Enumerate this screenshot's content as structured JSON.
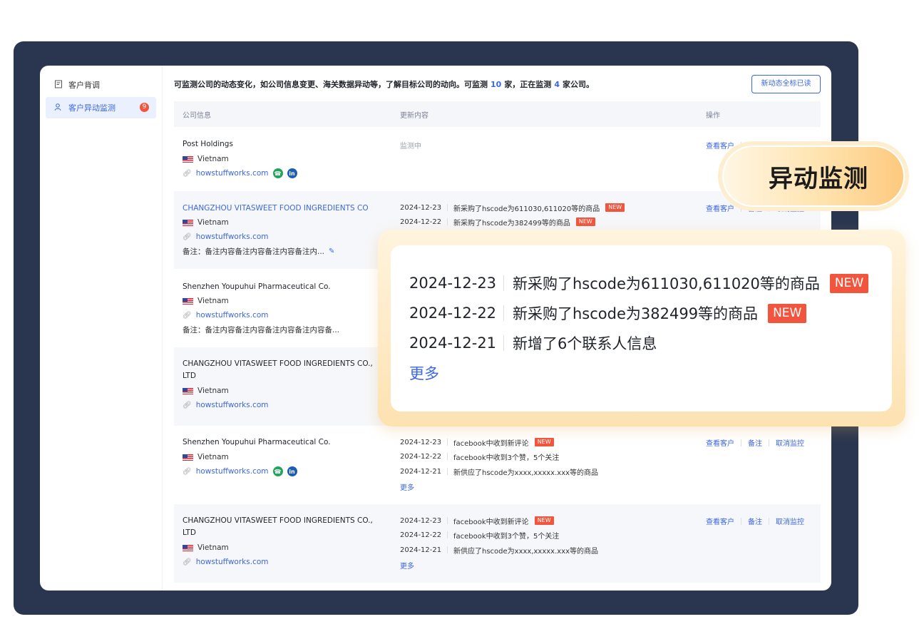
{
  "sidebar": {
    "items": [
      {
        "label": "客户背调",
        "icon": "document-icon",
        "active": false
      },
      {
        "label": "客户异动监测",
        "icon": "users-icon",
        "active": true,
        "badge": "9"
      }
    ]
  },
  "topbar": {
    "text_before": "可监测公司的动态变化，如公司信息变更、海关数据异动等，了解目标公司的动向。可监测",
    "limit": "10",
    "text_mid": "家，正在监测",
    "monitoring": "4",
    "text_after": "家公司。",
    "mark_read_label": "新动态全标已读"
  },
  "table": {
    "headers": [
      "公司信息",
      "更新内容",
      "操作"
    ],
    "ops": [
      "查看客户",
      "备注",
      "取消监控"
    ],
    "rows": [
      {
        "name": "Post Holdings",
        "country": "Vietnam",
        "url": "howstuffworks.com",
        "status": "监测中"
      },
      {
        "name": "CHANGZHOU VITASWEET FOOD INGREDIENTS CO",
        "country": "Vietnam",
        "url": "howstuffworks.com",
        "note": "备注：备注内容备注内容备注内容备注内...",
        "updates": [
          {
            "date": "2024-12-23",
            "text": "新采购了hscode为611030,611020等的商品",
            "new": "NEW"
          },
          {
            "date": "2024-12-22",
            "text": "新采购了hscode为382499等的商品",
            "new": "NEW"
          }
        ]
      },
      {
        "name": "Shenzhen Youpuhui Pharmaceutical Co.",
        "country": "Vietnam",
        "url": "howstuffworks.com",
        "note": "备注：备注内容备注内容备注内容备注内容备..."
      },
      {
        "name": "CHANGZHOU VITASWEET FOOD INGREDIENTS CO., LTD",
        "country": "Vietnam",
        "url": "howstuffworks.com"
      },
      {
        "name": "Shenzhen Youpuhui Pharmaceutical Co.",
        "country": "Vietnam",
        "url": "howstuffworks.com",
        "updates": [
          {
            "date": "2024-12-23",
            "text": "facebook中收到新评论",
            "new": "NEW"
          },
          {
            "date": "2024-12-22",
            "text": "facebook中收到3个赞，5个关注"
          },
          {
            "date": "2024-12-21",
            "text": "新供应了hscode为xxxx,xxxxx.xxx等的商品"
          }
        ],
        "more": "更多"
      },
      {
        "name": "CHANGZHOU VITASWEET FOOD INGREDIENTS CO., LTD",
        "country": "Vietnam",
        "url": "howstuffworks.com",
        "updates": [
          {
            "date": "2024-12-23",
            "text": "facebook中收到新评论",
            "new": "NEW"
          },
          {
            "date": "2024-12-22",
            "text": "facebook中收到3个赞，5个关注"
          },
          {
            "date": "2024-12-21",
            "text": "新供应了hscode为xxxx,xxxxx.xxx等的商品"
          }
        ],
        "more": "更多"
      }
    ]
  },
  "callout": {
    "title": "异动监测",
    "lines": [
      {
        "date": "2024-12-23",
        "text": "新采购了hscode为611030,611020等的商品",
        "new": "NEW"
      },
      {
        "date": "2024-12-22",
        "text": "新采购了hscode为382499等的商品",
        "new": "NEW"
      },
      {
        "date": "2024-12-21",
        "text": "新增了6个联系人信息"
      }
    ],
    "more": "更多"
  },
  "colors": {
    "frame": "#2a3650",
    "accent": "#3b66e6",
    "new_badge": "#f2553d",
    "callout": "#fdc97e"
  }
}
